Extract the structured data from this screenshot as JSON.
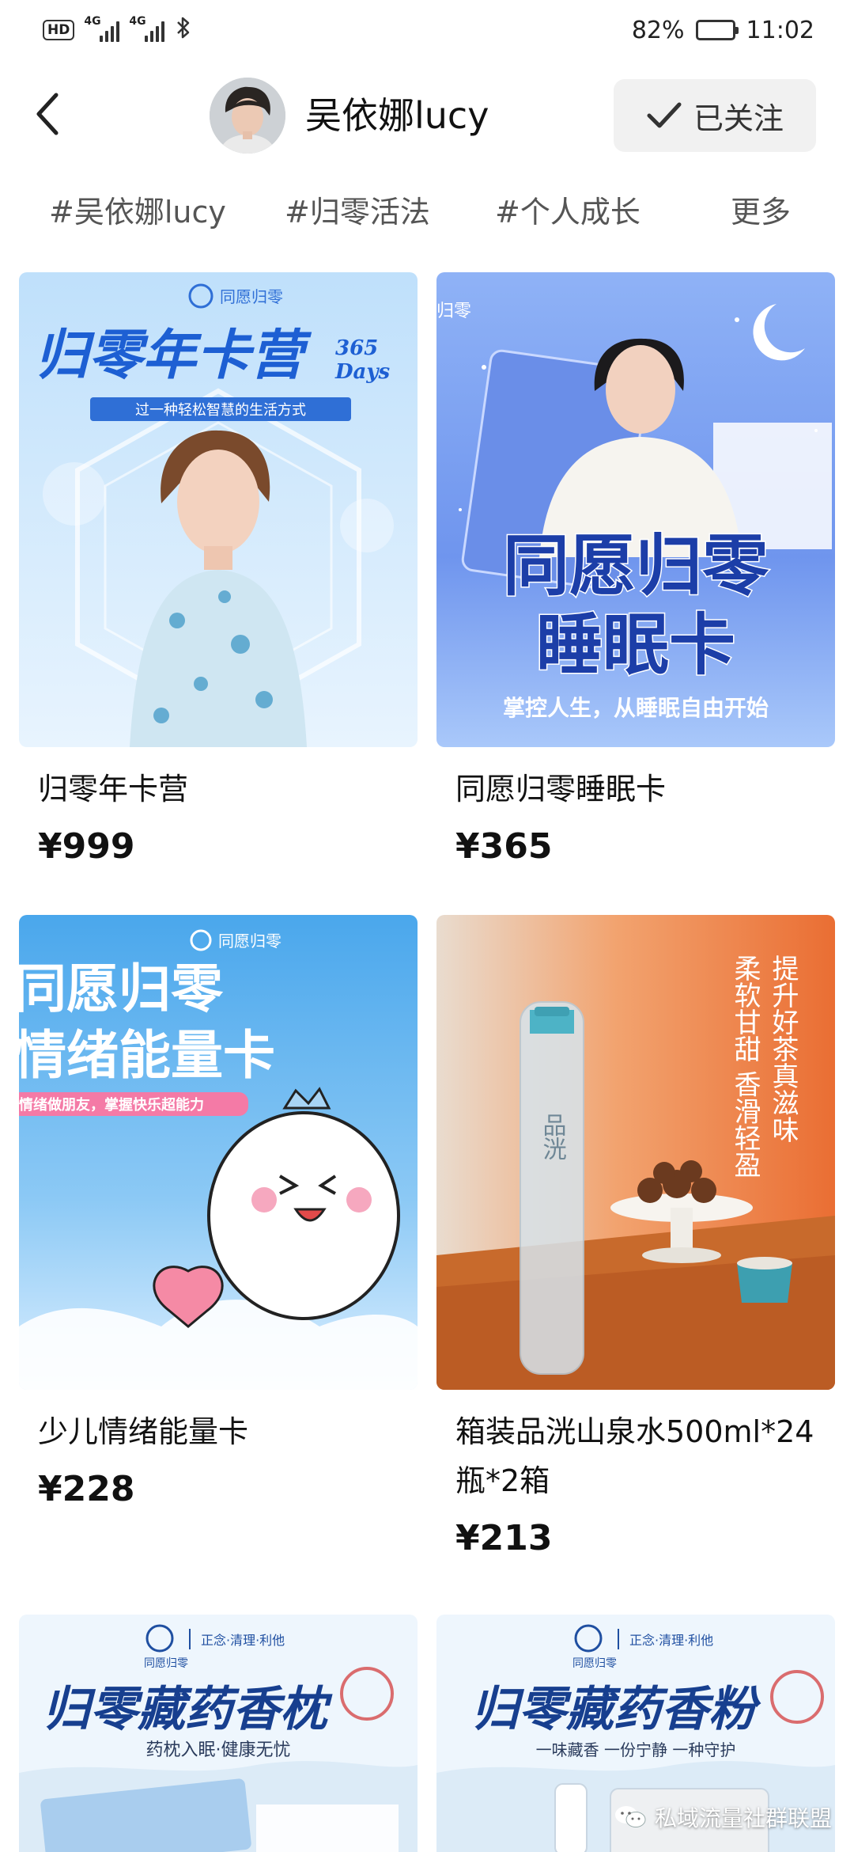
{
  "status_bar": {
    "hd": "HD",
    "net1": "4G",
    "net2": "4G",
    "battery_text": "82%",
    "battery_level": 0.82,
    "time": "11:02"
  },
  "header": {
    "back_icon": "chevron-left-icon",
    "shop_name": "吴依娜lucy",
    "follow_label": "已关注",
    "follow_icon": "check-icon"
  },
  "tags": [
    "#吴依娜lucy",
    "#归零活法",
    "#个人成长",
    "更多"
  ],
  "products": [
    {
      "title": "归零年卡营",
      "price": "¥999",
      "image": {
        "brand": "同愿归零",
        "headline": "归零年卡营",
        "badge_top": "365",
        "badge_bottom": "Days",
        "tagline": "过一种轻松智慧的生活方式"
      }
    },
    {
      "title": "同愿归零睡眠卡",
      "price": "¥365",
      "image": {
        "brand": "归零",
        "headline_1": "同愿归零",
        "headline_2": "睡眠卡",
        "tagline": "掌控人生，从睡眠自由开始"
      }
    },
    {
      "title": "少儿情绪能量卡",
      "price": "¥228",
      "image": {
        "brand": "同愿归零",
        "headline_1": "同愿归零",
        "headline_2": "情绪能量卡",
        "tagline": "情绪做朋友，掌握快乐超能力"
      }
    },
    {
      "title": "箱装品洸山泉水500ml*24瓶*2箱",
      "price": "¥213",
      "image": {
        "bottle_text": "品洸",
        "line_1": "提升好茶真滋味",
        "line_2": "柔软甘甜 香滑轻盈"
      }
    },
    {
      "title": "",
      "price": "",
      "image": {
        "brand": "同愿归零",
        "slogan": "正念·清理·利他",
        "headline": "归零藏药香枕",
        "tagline": "药枕入眠·健康无忧"
      }
    },
    {
      "title": "",
      "price": "",
      "image": {
        "brand": "同愿归零",
        "slogan": "正念·清理·利他",
        "headline": "归零藏药香粉",
        "tagline": "一味藏香 一份宁静 一种守护"
      }
    }
  ],
  "watermark": {
    "icon": "wechat-icon",
    "text": "私域流量社群联盟"
  },
  "colors": {
    "price": "#111111",
    "follow_bg": "#f1f1f1",
    "tag_text": "#555555",
    "card1_bg": "#cfe6fb",
    "card2_bg": "#7fa3f2",
    "card3_bg": "#5fb4ef",
    "card4_bg": "#e8793f",
    "card5_bg": "#e9f3fb"
  }
}
